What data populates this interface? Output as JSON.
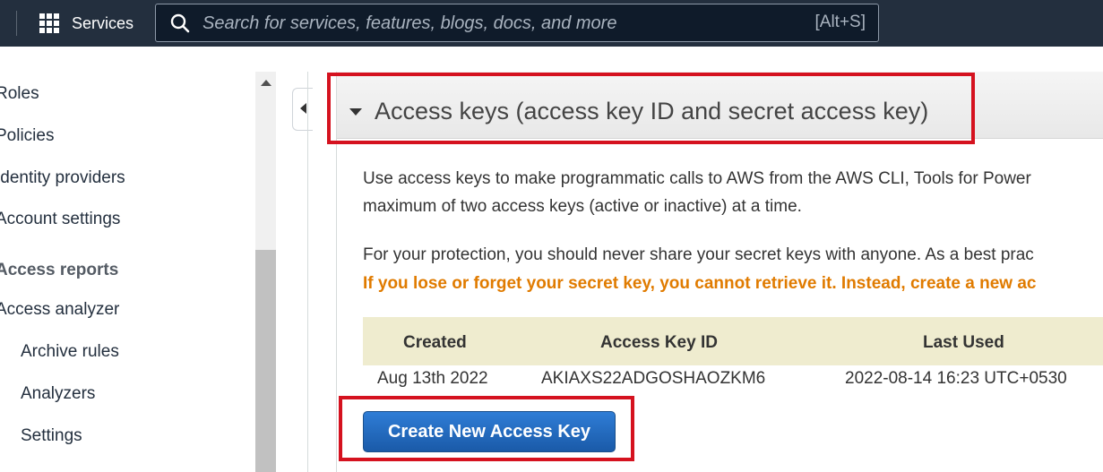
{
  "topbar": {
    "services_label": "Services",
    "search_placeholder": "Search for services, features, blogs, docs, and more",
    "search_shortcut": "[Alt+S]"
  },
  "sidebar": {
    "items": [
      {
        "label": "Roles"
      },
      {
        "label": "Policies"
      },
      {
        "label": "Identity providers"
      },
      {
        "label": "Account settings"
      },
      {
        "label": "Access reports"
      },
      {
        "label": "Access analyzer"
      },
      {
        "label": "Archive rules"
      },
      {
        "label": "Analyzers"
      },
      {
        "label": "Settings"
      }
    ]
  },
  "access_keys": {
    "section_title": "Access keys (access key ID and secret access key)",
    "description_line1": "Use access keys to make programmatic calls to AWS from the AWS CLI, Tools for Power",
    "description_line2": "maximum of two access keys (active or inactive) at a time.",
    "protection_text": "For your protection, you should never share your secret keys with anyone. As a best prac",
    "warning_text": "If you lose or forget your secret key, you cannot retrieve it. Instead, create a new ac",
    "table": {
      "headers": [
        "Created",
        "Access Key ID",
        "Last Used"
      ],
      "rows": [
        {
          "created": "Aug 13th 2022",
          "access_key_id": "AKIAXS22ADGOSHAOZKM6",
          "last_used": "2022-08-14 16:23 UTC+0530"
        }
      ]
    },
    "create_button_label": "Create New Access Key"
  },
  "colors": {
    "topbar_bg": "#232f3e",
    "warning": "#e07b00",
    "table_header_bg": "#efeccf",
    "button_blue": "#1a5aa8",
    "highlight_red": "#d5121f"
  },
  "icons": {
    "services": "grid-icon",
    "search": "search-icon",
    "section_toggle": "caret-down-icon",
    "collapse_sidebar": "caret-left-icon",
    "scroll_up": "scroll-up-icon"
  }
}
